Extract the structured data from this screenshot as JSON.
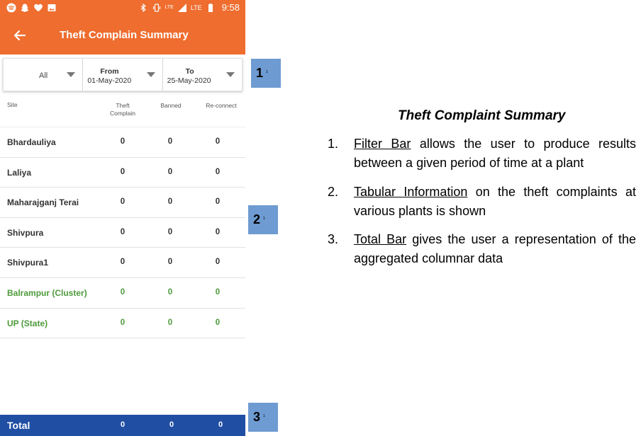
{
  "statusbar": {
    "left_icons": [
      "spotify-icon",
      "snapchat-icon",
      "heart-icon",
      "image-icon"
    ],
    "indicators": [
      "bluetooth-icon",
      "vibrate-icon",
      "LTE",
      "LTE",
      "battery-icon"
    ],
    "lte_call": "LTE",
    "lte_signal": "LTE",
    "time": "9:58"
  },
  "appbar": {
    "title": "Theft Complain Summary",
    "back_icon": "arrow-left-icon"
  },
  "filters": {
    "site": "All",
    "from_label": "From",
    "from_value": "01-May-2020",
    "to_label": "To",
    "to_value": "25-May-2020"
  },
  "table": {
    "headers": {
      "site": "Site",
      "theft_line1": "Theft",
      "theft_line2": "Complain",
      "banned": "Banned",
      "reconnect": "Re-connect"
    },
    "rows": [
      {
        "site": "Bhardauliya",
        "theft": "0",
        "banned": "0",
        "reconnect": "0"
      },
      {
        "site": "Laliya",
        "theft": "0",
        "banned": "0",
        "reconnect": "0"
      },
      {
        "site": "Maharajganj Terai",
        "theft": "0",
        "banned": "0",
        "reconnect": "0"
      },
      {
        "site": "Shivpura",
        "theft": "0",
        "banned": "0",
        "reconnect": "0"
      },
      {
        "site": "Shivpura1",
        "theft": "0",
        "banned": "0",
        "reconnect": "0"
      },
      {
        "site": "Balrampur (Cluster)",
        "theft": "0",
        "banned": "0",
        "reconnect": "0"
      },
      {
        "site": "UP (State)",
        "theft": "0",
        "banned": "0",
        "reconnect": "0"
      }
    ]
  },
  "total": {
    "label": "Total",
    "theft": "0",
    "banned": "0",
    "reconnect": "0"
  },
  "callouts": [
    {
      "num": "1",
      "sub": "1"
    },
    {
      "num": "2",
      "sub": "1"
    },
    {
      "num": "3",
      "sub": "1"
    }
  ],
  "description": {
    "title": "Theft Complaint Summary",
    "items": [
      {
        "idx": "1.",
        "key": "Filter Bar",
        "text": " allows the user to produce results between a given period of time at a plant"
      },
      {
        "idx": "2.",
        "key": "Tabular Information",
        "text": " on the theft complaints at various plants is shown"
      },
      {
        "idx": "3.",
        "key": "Total Bar",
        "text": " gives the user a representation of the aggregated columnar data"
      }
    ]
  },
  "colors": {
    "appbar": "#ee6d2f",
    "total_bar": "#1f4ea3",
    "aggregate_text": "#4d9a3b",
    "callout": "#6e9bd1"
  }
}
